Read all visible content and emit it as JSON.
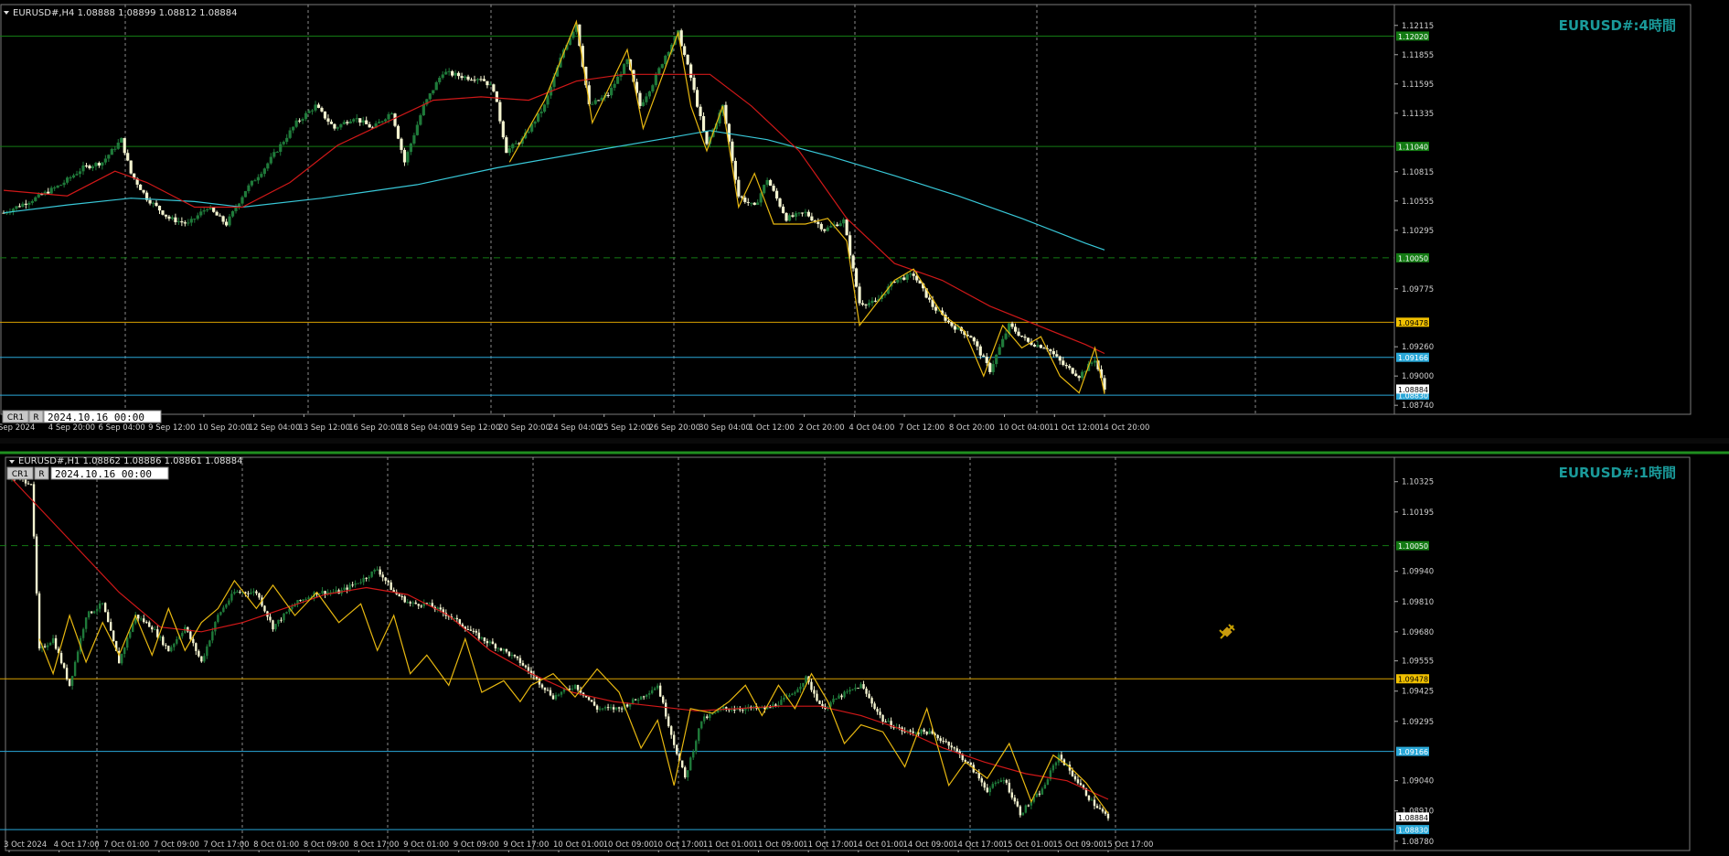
{
  "colors": {
    "background": "#000000",
    "grid": "#b8b8b8",
    "bull": "#1f7a3a",
    "bear": "#f4f4d0",
    "ma_red": "#d01818",
    "ma_cyan": "#38c8d8",
    "zigzag": "#e8b810",
    "green_level": "#137a13",
    "yellow_level": "#d8a000",
    "blue_level": "#2aa8d8",
    "panel_title": "#1a9a9a",
    "axis_text": "#d0d0d0"
  },
  "panels": [
    {
      "id": "h4",
      "header": "EURUSD#,H4  1.08888 1.08899 1.08812 1.08884",
      "title": "EURUSD#:4時間",
      "button_1": "CR1",
      "button_2": "R",
      "date_box": "2024.10.16 00:00",
      "price_ticks": [
        "1.12115",
        "1.11855",
        "1.11595",
        "1.11335",
        "1.10815",
        "1.10555",
        "1.10295",
        "1.09775",
        "1.09260",
        "1.09000",
        "1.08740"
      ],
      "time_labels": [
        "Sep 2024",
        "4 Sep 20:00",
        "6 Sep 04:00",
        "9 Sep 12:00",
        "10 Sep 20:00",
        "12 Sep 04:00",
        "13 Sep 12:00",
        "16 Sep 20:00",
        "18 Sep 04:00",
        "19 Sep 12:00",
        "20 Sep 20:00",
        "24 Sep 04:00",
        "25 Sep 12:00",
        "26 Sep 20:00",
        "30 Sep 04:00",
        "1 Oct 12:00",
        "2 Oct 20:00",
        "4 Oct 04:00",
        "7 Oct 12:00",
        "8 Oct 20:00",
        "10 Oct 04:00",
        "11 Oct 12:00",
        "14 Oct 20:00"
      ],
      "level_tags": {
        "green_top": "1.12020",
        "green_mid": "1.11040",
        "green_dash": "1.10050",
        "yellow": "1.09478",
        "blue": "1.09166",
        "last_price": "1.08884",
        "blue_low": "1.08830"
      }
    },
    {
      "id": "h1",
      "header": "EURUSD#,H1  1.08862 1.08886 1.08861 1.08884",
      "title": "EURUSD#:1時間",
      "button_1": "CR1",
      "button_2": "R",
      "date_box": "2024.10.16 00:00",
      "price_ticks": [
        "1.10325",
        "1.10195",
        "1.09940",
        "1.09810",
        "1.09680",
        "1.09555",
        "1.09425",
        "1.09295",
        "1.09040",
        "1.08910",
        "1.08780"
      ],
      "time_labels": [
        "3 Oct 2024",
        "4 Oct 17:00",
        "7 Oct 01:00",
        "7 Oct 09:00",
        "7 Oct 17:00",
        "8 Oct 01:00",
        "8 Oct 09:00",
        "8 Oct 17:00",
        "9 Oct 01:00",
        "9 Oct 09:00",
        "9 Oct 17:00",
        "10 Oct 01:00",
        "10 Oct 09:00",
        "10 Oct 17:00",
        "11 Oct 01:00",
        "11 Oct 09:00",
        "11 Oct 17:00",
        "14 Oct 01:00",
        "14 Oct 09:00",
        "14 Oct 17:00",
        "15 Oct 01:00",
        "15 Oct 09:00",
        "15 Oct 17:00"
      ],
      "level_tags": {
        "green_dash": "1.10050",
        "yellow": "1.09478",
        "blue": "1.09166",
        "last_price": "1.08884",
        "blue_low": "1.08830"
      }
    }
  ],
  "chart_data": [
    {
      "type": "candlestick",
      "symbol": "EURUSD#",
      "timeframe": "H4",
      "last_ohlc": {
        "open": 1.08888,
        "high": 1.08899,
        "low": 1.08812,
        "close": 1.08884
      },
      "ylim": [
        1.0866,
        1.123
      ],
      "horizontal_levels": [
        {
          "price": 1.1202,
          "style": "solid",
          "color": "green"
        },
        {
          "price": 1.1104,
          "style": "solid",
          "color": "green"
        },
        {
          "price": 1.1005,
          "style": "dashed",
          "color": "green"
        },
        {
          "price": 1.09478,
          "style": "solid",
          "color": "yellow"
        },
        {
          "price": 1.09166,
          "style": "solid",
          "color": "blue"
        },
        {
          "price": 1.0883,
          "style": "solid",
          "color": "blue"
        }
      ],
      "close_path": [
        [
          0,
          1.1045
        ],
        [
          10,
          1.1058
        ],
        [
          18,
          1.107
        ],
        [
          25,
          1.1085
        ],
        [
          31,
          1.109
        ],
        [
          37,
          1.111
        ],
        [
          40,
          1.108
        ],
        [
          45,
          1.1058
        ],
        [
          52,
          1.104
        ],
        [
          58,
          1.1035
        ],
        [
          64,
          1.105
        ],
        [
          70,
          1.1035
        ],
        [
          76,
          1.1065
        ],
        [
          82,
          1.1085
        ],
        [
          87,
          1.1105
        ],
        [
          92,
          1.1125
        ],
        [
          98,
          1.114
        ],
        [
          104,
          1.112
        ],
        [
          110,
          1.113
        ],
        [
          116,
          1.112
        ],
        [
          122,
          1.1135
        ],
        [
          126,
          1.109
        ],
        [
          132,
          1.114
        ],
        [
          138,
          1.117
        ],
        [
          146,
          1.1165
        ],
        [
          150,
          1.1165
        ],
        [
          154,
          1.1155
        ],
        [
          158,
          1.11
        ],
        [
          163,
          1.111
        ],
        [
          170,
          1.114
        ],
        [
          176,
          1.119
        ],
        [
          180,
          1.1213
        ],
        [
          184,
          1.114
        ],
        [
          190,
          1.115
        ],
        [
          196,
          1.118
        ],
        [
          200,
          1.114
        ],
        [
          204,
          1.116
        ],
        [
          208,
          1.1185
        ],
        [
          212,
          1.1205
        ],
        [
          216,
          1.1165
        ],
        [
          221,
          1.1105
        ],
        [
          226,
          1.114
        ],
        [
          231,
          1.106
        ],
        [
          236,
          1.105
        ],
        [
          240,
          1.1075
        ],
        [
          246,
          1.104
        ],
        [
          252,
          1.1045
        ],
        [
          258,
          1.103
        ],
        [
          264,
          1.1038
        ],
        [
          269,
          1.0965
        ],
        [
          274,
          1.0965
        ],
        [
          280,
          1.0985
        ],
        [
          286,
          1.099
        ],
        [
          292,
          1.0962
        ],
        [
          298,
          1.0945
        ],
        [
          304,
          1.0935
        ],
        [
          310,
          1.0905
        ],
        [
          316,
          1.0945
        ],
        [
          322,
          1.093
        ],
        [
          328,
          1.0925
        ],
        [
          333,
          1.091
        ],
        [
          338,
          1.09
        ],
        [
          343,
          1.0915
        ],
        [
          346,
          1.0888
        ]
      ],
      "ma_red": [
        [
          0,
          1.1065
        ],
        [
          20,
          1.106
        ],
        [
          35,
          1.1082
        ],
        [
          45,
          1.1072
        ],
        [
          60,
          1.105
        ],
        [
          75,
          1.105
        ],
        [
          90,
          1.1072
        ],
        [
          105,
          1.1105
        ],
        [
          120,
          1.1125
        ],
        [
          135,
          1.1145
        ],
        [
          150,
          1.1148
        ],
        [
          165,
          1.1145
        ],
        [
          180,
          1.1162
        ],
        [
          195,
          1.1168
        ],
        [
          210,
          1.1168
        ],
        [
          222,
          1.1168
        ],
        [
          235,
          1.114
        ],
        [
          250,
          1.11
        ],
        [
          265,
          1.104
        ],
        [
          280,
          1.1
        ],
        [
          295,
          1.0985
        ],
        [
          310,
          1.0962
        ],
        [
          325,
          1.0945
        ],
        [
          340,
          1.0928
        ],
        [
          346,
          1.092
        ]
      ],
      "ma_cyan": [
        [
          0,
          1.1045
        ],
        [
          20,
          1.1052
        ],
        [
          40,
          1.1058
        ],
        [
          60,
          1.1055
        ],
        [
          75,
          1.105
        ],
        [
          100,
          1.1058
        ],
        [
          130,
          1.107
        ],
        [
          155,
          1.1085
        ],
        [
          185,
          1.11
        ],
        [
          210,
          1.1112
        ],
        [
          222,
          1.1118
        ],
        [
          240,
          1.111
        ],
        [
          260,
          1.1095
        ],
        [
          280,
          1.1078
        ],
        [
          300,
          1.106
        ],
        [
          320,
          1.104
        ],
        [
          340,
          1.1018
        ],
        [
          346,
          1.1012
        ]
      ],
      "zigzag": [
        [
          159,
          1.109
        ],
        [
          170,
          1.1145
        ],
        [
          180,
          1.1215
        ],
        [
          185,
          1.1125
        ],
        [
          196,
          1.119
        ],
        [
          201,
          1.112
        ],
        [
          212,
          1.1205
        ],
        [
          216,
          1.114
        ],
        [
          221,
          1.11
        ],
        [
          226,
          1.114
        ],
        [
          231,
          1.105
        ],
        [
          236,
          1.108
        ],
        [
          242,
          1.1035
        ],
        [
          252,
          1.1035
        ],
        [
          259,
          1.104
        ],
        [
          265,
          1.102
        ],
        [
          269,
          1.0945
        ],
        [
          280,
          1.0985
        ],
        [
          286,
          1.0995
        ],
        [
          295,
          1.0955
        ],
        [
          302,
          1.094
        ],
        [
          308,
          1.09
        ],
        [
          314,
          1.0945
        ],
        [
          320,
          1.0925
        ],
        [
          326,
          1.0935
        ],
        [
          332,
          1.09
        ],
        [
          338,
          1.0885
        ],
        [
          343,
          1.0925
        ],
        [
          346,
          1.0884
        ]
      ]
    },
    {
      "type": "candlestick",
      "symbol": "EURUSD#",
      "timeframe": "H1",
      "last_ohlc": {
        "open": 1.08862,
        "high": 1.08886,
        "low": 1.08861,
        "close": 1.08884
      },
      "ylim": [
        1.0874,
        1.1043
      ],
      "horizontal_levels": [
        {
          "price": 1.1005,
          "style": "dashed",
          "color": "green"
        },
        {
          "price": 1.09478,
          "style": "solid",
          "color": "yellow"
        },
        {
          "price": 1.09166,
          "style": "solid",
          "color": "blue"
        },
        {
          "price": 1.0883,
          "style": "solid",
          "color": "blue"
        }
      ],
      "close_path": [
        [
          0,
          1.1035
        ],
        [
          8,
          1.1032
        ],
        [
          11,
          1.096
        ],
        [
          16,
          1.0965
        ],
        [
          22,
          1.0945
        ],
        [
          28,
          1.0975
        ],
        [
          34,
          1.098
        ],
        [
          40,
          1.0955
        ],
        [
          46,
          1.0975
        ],
        [
          52,
          1.097
        ],
        [
          58,
          1.096
        ],
        [
          64,
          1.097
        ],
        [
          70,
          1.0955
        ],
        [
          76,
          1.0975
        ],
        [
          82,
          1.0985
        ],
        [
          90,
          1.0985
        ],
        [
          96,
          1.097
        ],
        [
          104,
          1.098
        ],
        [
          112,
          1.0985
        ],
        [
          120,
          1.0985
        ],
        [
          128,
          1.099
        ],
        [
          134,
          1.0995
        ],
        [
          140,
          1.0985
        ],
        [
          146,
          1.098
        ],
        [
          152,
          1.098
        ],
        [
          160,
          1.0975
        ],
        [
          166,
          1.097
        ],
        [
          172,
          1.0965
        ],
        [
          180,
          1.096
        ],
        [
          186,
          1.0955
        ],
        [
          190,
          1.095
        ],
        [
          198,
          1.094
        ],
        [
          206,
          1.0945
        ],
        [
          214,
          1.0935
        ],
        [
          222,
          1.0935
        ],
        [
          230,
          1.094
        ],
        [
          236,
          1.0945
        ],
        [
          242,
          1.092
        ],
        [
          246,
          1.0905
        ],
        [
          252,
          1.093
        ],
        [
          260,
          1.0935
        ],
        [
          268,
          1.0935
        ],
        [
          276,
          1.0935
        ],
        [
          284,
          1.094
        ],
        [
          290,
          1.0948
        ],
        [
          296,
          1.0935
        ],
        [
          302,
          1.094
        ],
        [
          310,
          1.0945
        ],
        [
          318,
          1.093
        ],
        [
          326,
          1.0925
        ],
        [
          334,
          1.0925
        ],
        [
          342,
          1.092
        ],
        [
          350,
          1.091
        ],
        [
          356,
          1.09
        ],
        [
          362,
          1.0905
        ],
        [
          368,
          1.089
        ],
        [
          376,
          1.09
        ],
        [
          382,
          1.0915
        ],
        [
          388,
          1.0905
        ],
        [
          394,
          1.0895
        ],
        [
          400,
          1.0888
        ]
      ],
      "ma_red": [
        [
          0,
          1.1035
        ],
        [
          20,
          1.101
        ],
        [
          40,
          1.0985
        ],
        [
          55,
          1.097
        ],
        [
          70,
          1.0968
        ],
        [
          85,
          1.0972
        ],
        [
          100,
          1.0978
        ],
        [
          115,
          1.0984
        ],
        [
          130,
          1.0987
        ],
        [
          145,
          1.0984
        ],
        [
          160,
          1.0975
        ],
        [
          175,
          1.096
        ],
        [
          190,
          1.095
        ],
        [
          205,
          1.0942
        ],
        [
          220,
          1.0938
        ],
        [
          235,
          1.0936
        ],
        [
          250,
          1.0934
        ],
        [
          265,
          1.0935
        ],
        [
          280,
          1.0936
        ],
        [
          295,
          1.0936
        ],
        [
          310,
          1.0932
        ],
        [
          325,
          1.0926
        ],
        [
          340,
          1.0918
        ],
        [
          355,
          1.0912
        ],
        [
          370,
          1.0907
        ],
        [
          385,
          1.0904
        ],
        [
          400,
          1.0896
        ]
      ],
      "zigzag": [
        [
          11,
          1.0965
        ],
        [
          16,
          1.095
        ],
        [
          22,
          1.0975
        ],
        [
          28,
          1.0955
        ],
        [
          34,
          1.0972
        ],
        [
          40,
          1.0958
        ],
        [
          46,
          1.0975
        ],
        [
          52,
          1.0958
        ],
        [
          58,
          1.0978
        ],
        [
          64,
          1.096
        ],
        [
          70,
          1.0972
        ],
        [
          76,
          1.0978
        ],
        [
          82,
          1.099
        ],
        [
          90,
          1.0978
        ],
        [
          96,
          1.0988
        ],
        [
          104,
          1.0975
        ],
        [
          112,
          1.0985
        ],
        [
          120,
          1.0972
        ],
        [
          128,
          1.098
        ],
        [
          134,
          1.096
        ],
        [
          140,
          1.0975
        ],
        [
          146,
          1.095
        ],
        [
          152,
          1.0958
        ],
        [
          160,
          1.0945
        ],
        [
          166,
          1.0965
        ],
        [
          172,
          1.0942
        ],
        [
          180,
          1.0947
        ],
        [
          186,
          1.0938
        ],
        [
          190,
          1.0945
        ],
        [
          198,
          1.095
        ],
        [
          206,
          1.094
        ],
        [
          214,
          1.0952
        ],
        [
          222,
          1.0942
        ],
        [
          230,
          1.0918
        ],
        [
          236,
          1.093
        ],
        [
          242,
          1.0902
        ],
        [
          248,
          1.0935
        ],
        [
          256,
          1.0933
        ],
        [
          262,
          1.0938
        ],
        [
          268,
          1.0945
        ],
        [
          274,
          1.0932
        ],
        [
          280,
          1.0945
        ],
        [
          286,
          1.0935
        ],
        [
          292,
          1.095
        ],
        [
          298,
          1.0938
        ],
        [
          304,
          1.092
        ],
        [
          310,
          1.0928
        ],
        [
          318,
          1.0925
        ],
        [
          326,
          1.091
        ],
        [
          334,
          1.0935
        ],
        [
          342,
          1.0902
        ],
        [
          348,
          1.0912
        ],
        [
          356,
          1.0905
        ],
        [
          364,
          1.092
        ],
        [
          372,
          1.0895
        ],
        [
          380,
          1.0915
        ],
        [
          386,
          1.091
        ],
        [
          392,
          1.0903
        ],
        [
          400,
          1.089
        ]
      ]
    }
  ]
}
